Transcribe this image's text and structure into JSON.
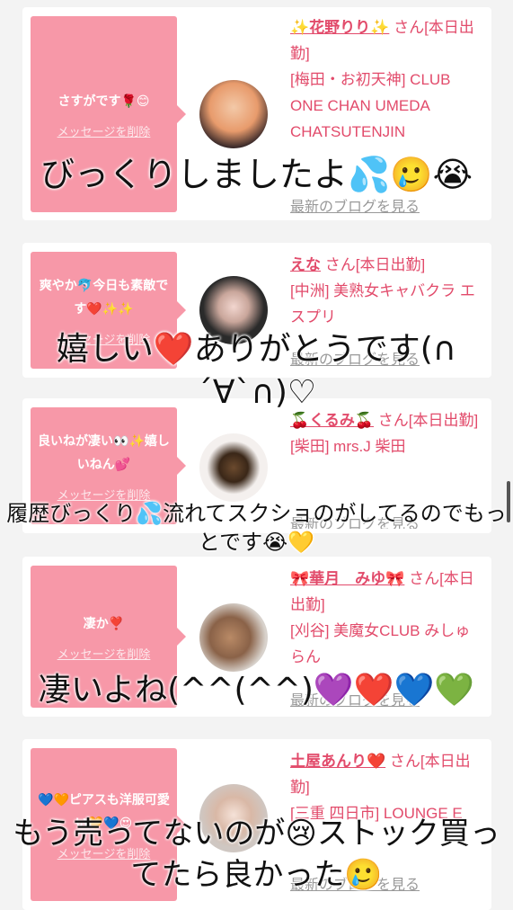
{
  "cards": [
    {
      "message": "さすがです🌹😊",
      "delete_label": "メッセージを削除",
      "name": "✨花野りり✨",
      "suffix": "さん[本日出勤]",
      "shop": "[梅田・お初天神] CLUB ONE CHAN UMEDA CHATSUTENJIN",
      "blog": "最新のブログを見る",
      "caption": "びっくりしましたよ💦🥲😭"
    },
    {
      "message": "爽やか🐬今日も素敵です❤️✨✨",
      "delete_label": "メッセージを削除",
      "name": "えな",
      "suffix": "さん[本日出勤]",
      "shop": "[中洲] 美熟女キャバクラ エスプリ",
      "blog": "最新のブログを見る",
      "caption": "嬉しい❤️ありがとうです(∩´∀`∩)♡"
    },
    {
      "message": "良いねが凄い👀✨嬉しいねん💕",
      "delete_label": "メッセージを削除",
      "name": "🍒くるみ🍒",
      "suffix": "さん[本日出勤]",
      "shop": "[柴田] mrs.J 柴田",
      "blog": "最新のブログを見る",
      "caption": "履歴びっくり💦流れてスクショのがしてるのでもっとです😭💛"
    },
    {
      "message": "凄か❣️",
      "delete_label": "メッセージを削除",
      "name": "🎀華月　みゆ🎀",
      "suffix": "さん[本日出勤]",
      "shop": "[刈谷] 美魔女CLUB みしゅらん",
      "blog": "最新のブログを見る",
      "caption": "凄いよね(^^(^^)💜❤️💙💚"
    },
    {
      "message": "💙🧡ピアスも洋服可愛い🧡💙😍",
      "delete_label": "メッセージを削除",
      "name": "土屋あんり❤️",
      "suffix": "さん[本日出勤]",
      "shop": "[三重 四日市] LOUNGE E",
      "blog": "最新のブログを見る",
      "caption": "もう売ってないのが😢ストック買ってたら良かった🥲"
    }
  ],
  "colors": {
    "bubble": "#f798a8",
    "accent": "#e24b6b",
    "background": "#f3f3f3"
  }
}
